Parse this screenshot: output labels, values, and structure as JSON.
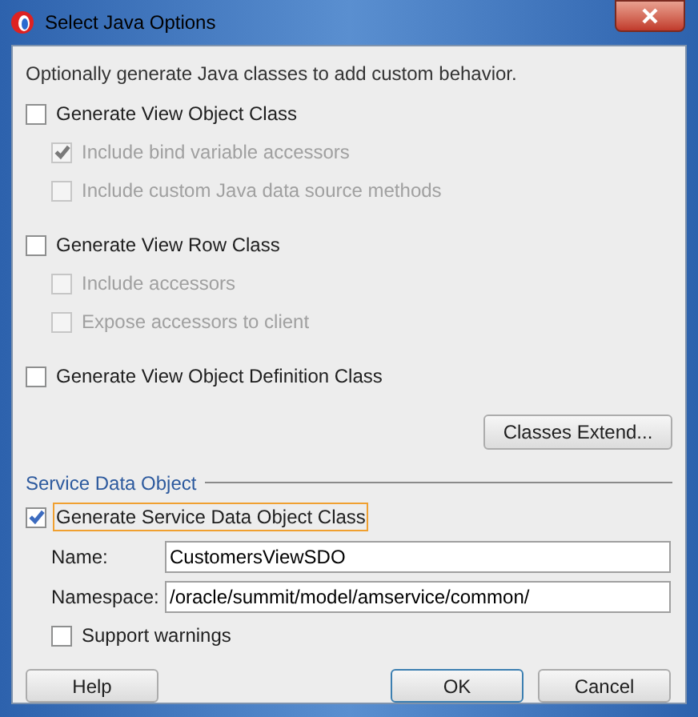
{
  "window": {
    "title": "Select Java Options"
  },
  "description": "Optionally generate Java classes to add custom behavior.",
  "options": [
    {
      "label": "Generate View Object Class",
      "checked": false,
      "disabled": false,
      "children": [
        {
          "label": "Include bind variable accessors",
          "checked": true,
          "disabled": true
        },
        {
          "label": "Include custom Java data source methods",
          "checked": false,
          "disabled": true
        }
      ]
    },
    {
      "label": "Generate View Row Class",
      "checked": false,
      "disabled": false,
      "children": [
        {
          "label": "Include accessors",
          "checked": false,
          "disabled": true
        },
        {
          "label": "Expose accessors to client",
          "checked": false,
          "disabled": true
        }
      ]
    },
    {
      "label": "Generate View Object Definition Class",
      "checked": false,
      "disabled": false
    }
  ],
  "classes_extend_button": "Classes Extend...",
  "sdo": {
    "heading": "Service Data Object",
    "generate": {
      "label": "Generate Service Data Object Class",
      "checked": true,
      "focused": true
    },
    "fields": [
      {
        "label": "Name:",
        "value": "CustomersViewSDO"
      },
      {
        "label": "Namespace:",
        "value": "/oracle/summit/model/amservice/common/"
      }
    ],
    "support_warnings": {
      "label": "Support warnings",
      "checked": false
    }
  },
  "buttons": [
    {
      "label": "Help",
      "default": false
    },
    {
      "label": "OK",
      "default": true
    },
    {
      "label": "Cancel",
      "default": false
    }
  ]
}
